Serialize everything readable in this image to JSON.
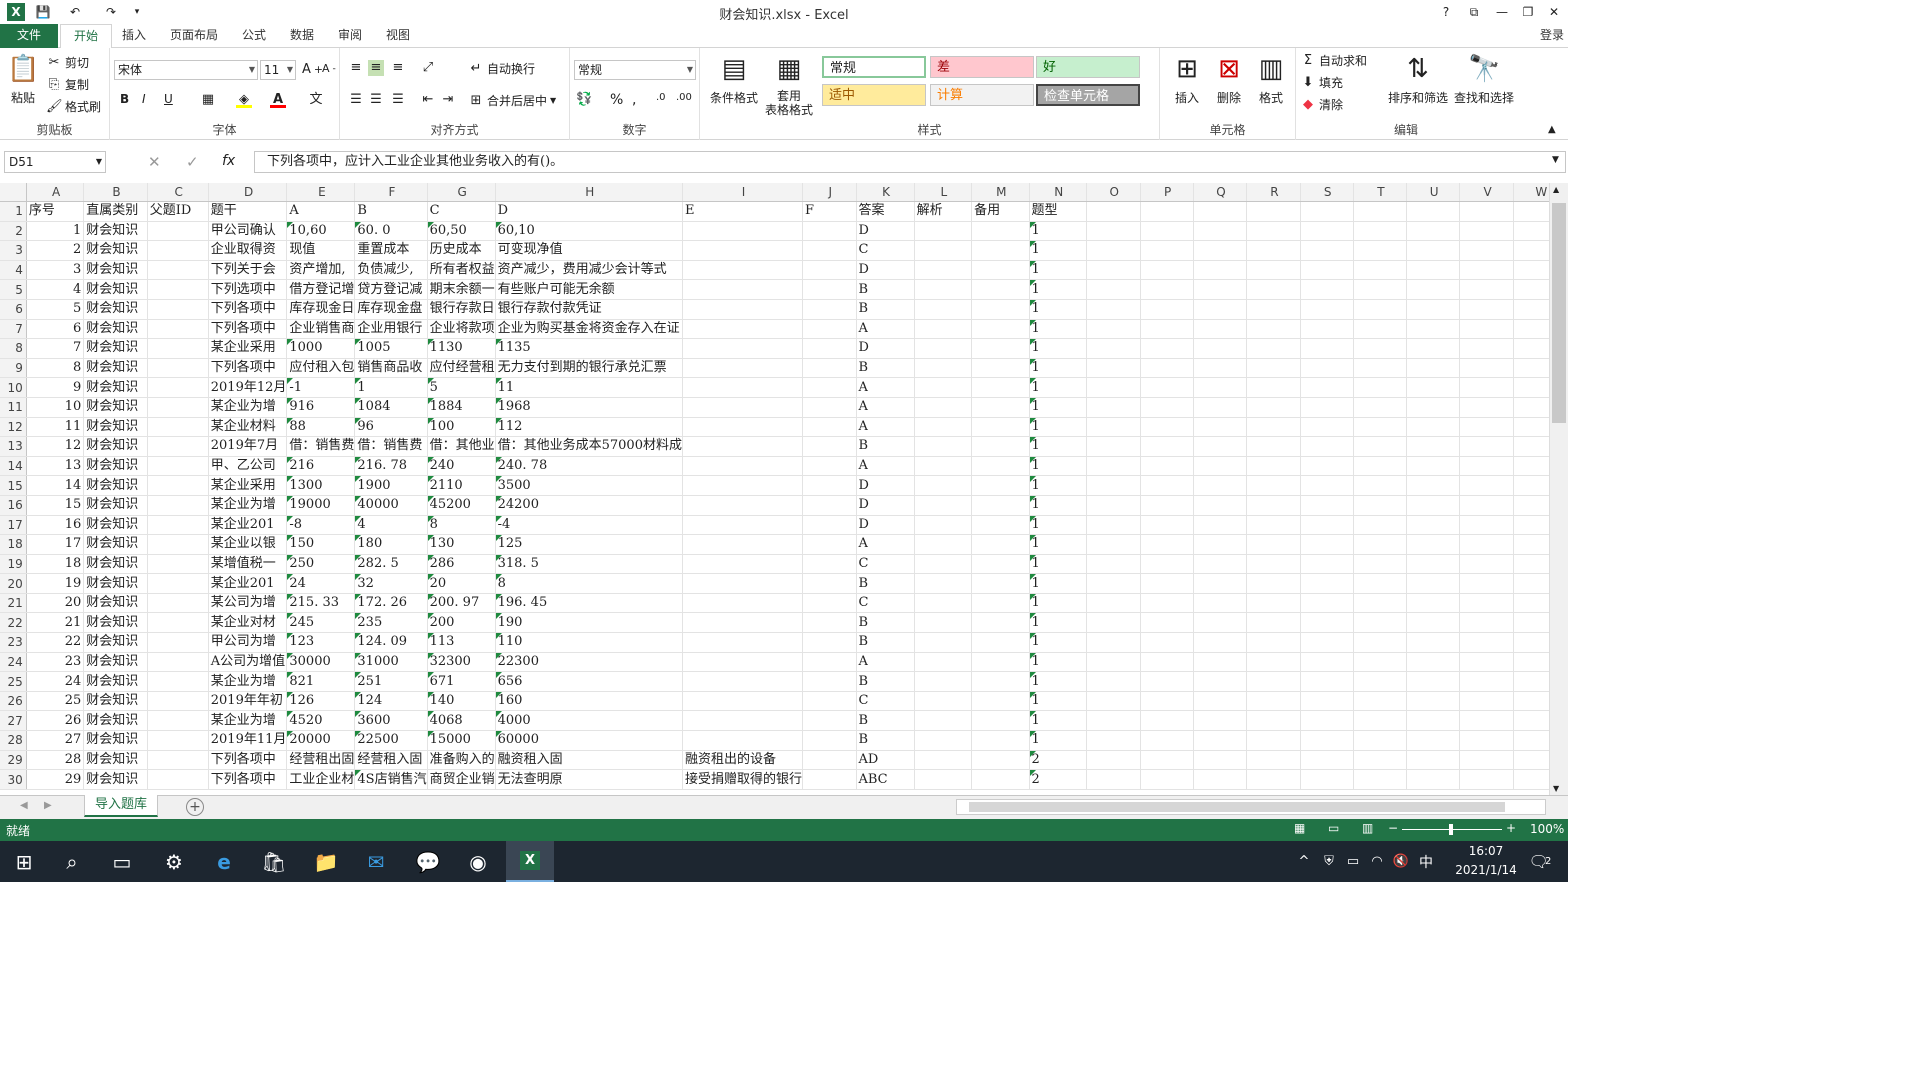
{
  "title_bar": {
    "doc_title": "财会知识.xlsx - Excel",
    "help": "?",
    "restore": "⧉",
    "minimize": "—",
    "maximize": "❐",
    "close": "✕"
  },
  "ribbon_tabs": [
    "文件",
    "开始",
    "插入",
    "页面布局",
    "公式",
    "数据",
    "审阅",
    "视图"
  ],
  "login": "登录",
  "clipboard": {
    "paste": "粘贴",
    "cut": "剪切",
    "copy": "复制",
    "format_painter": "格式刷",
    "label": "剪贴板"
  },
  "font": {
    "name": "宋体",
    "size": "11",
    "label": "字体",
    "bold": "B",
    "italic": "I",
    "underline": "U"
  },
  "alignment": {
    "wrap": "自动换行",
    "merge": "合并后居中",
    "label": "对齐方式"
  },
  "number": {
    "format": "常规",
    "percent": "%",
    "comma": ",",
    "label": "数字"
  },
  "styles": {
    "conditional": "条件格式",
    "table_format": "套用\n表格格式",
    "label": "样式",
    "cells": [
      {
        "text": "常规",
        "bg": "#ffffff",
        "fg": "#222222"
      },
      {
        "text": "差",
        "bg": "#ffc7ce",
        "fg": "#9c0006"
      },
      {
        "text": "好",
        "bg": "#c6efce",
        "fg": "#006100"
      },
      {
        "text": "适中",
        "bg": "#ffeb9c",
        "fg": "#9c5700"
      },
      {
        "text": "计算",
        "bg": "#f2f2f2",
        "fg": "#fa7d00"
      },
      {
        "text": "检查单元格",
        "bg": "#a5a5a5",
        "fg": "#ffffff"
      }
    ]
  },
  "cells_group": {
    "insert": "插入",
    "delete": "删除",
    "format": "格式",
    "label": "单元格"
  },
  "editing": {
    "autosum": "自动求和",
    "fill": "填充",
    "clear": "清除",
    "sort": "排序和筛选",
    "find": "查找和选择",
    "label": "编辑"
  },
  "formula_bar": {
    "name_box": "D51",
    "content": "下列各项中，应计入工业企业其他业务收入的有()。"
  },
  "columns": [
    "A",
    "B",
    "C",
    "D",
    "E",
    "F",
    "G",
    "H",
    "I",
    "J",
    "K",
    "L",
    "M",
    "N",
    "O",
    "P",
    "Q",
    "R",
    "S",
    "T",
    "U",
    "V",
    "W"
  ],
  "header_row": [
    "序号",
    "直属类别",
    "父题ID",
    "题干",
    "A",
    "B",
    "C",
    "D",
    "E",
    "F",
    "答案",
    "解析",
    "备用",
    "题型"
  ],
  "rows": [
    [
      "1",
      "财会知识",
      "",
      "甲公司确认",
      "10,60",
      "60. 0",
      "60,50",
      "60,10",
      "",
      "",
      "D",
      "",
      "",
      "1"
    ],
    [
      "2",
      "财会知识",
      "",
      "企业取得资",
      "现值",
      "重置成本",
      "历史成本",
      "可变现净值",
      "",
      "",
      "C",
      "",
      "",
      "1"
    ],
    [
      "3",
      "财会知识",
      "",
      "下列关于会",
      "资产增加,",
      "负债减少,",
      "所有者权益",
      "资产减少，费用减少会计等式",
      "",
      "",
      "D",
      "",
      "",
      "1"
    ],
    [
      "4",
      "财会知识",
      "",
      "下列选项中",
      "借方登记增",
      "贷方登记减",
      "期末余额一",
      "有些账户可能无余额",
      "",
      "",
      "B",
      "",
      "",
      "1"
    ],
    [
      "5",
      "财会知识",
      "",
      "下列各项中",
      "库存现金日",
      "库存现金盘",
      "银行存款日",
      "银行存款付款凭证",
      "",
      "",
      "B",
      "",
      "",
      "1"
    ],
    [
      "6",
      "财会知识",
      "",
      "下列各项中",
      "企业销售商",
      "企业用银行",
      "企业将款项",
      "企业为购买基金将资金存入在证",
      "",
      "",
      "A",
      "",
      "",
      "1"
    ],
    [
      "7",
      "财会知识",
      "",
      "某企业采用",
      "1000",
      "1005",
      "1130",
      "1135",
      "",
      "",
      "D",
      "",
      "",
      "1"
    ],
    [
      "8",
      "财会知识",
      "",
      "下列各项中",
      "应付租入包",
      "销售商品收",
      "应付经营租",
      "无力支付到期的银行承兑汇票",
      "",
      "",
      "B",
      "",
      "",
      "1"
    ],
    [
      "9",
      "财会知识",
      "",
      "2019年12月",
      "-1",
      "1",
      "5",
      "11",
      "",
      "",
      "A",
      "",
      "",
      "1"
    ],
    [
      "10",
      "财会知识",
      "",
      "某企业为增",
      "916",
      "1084",
      "1884",
      "1968",
      "",
      "",
      "A",
      "",
      "",
      "1"
    ],
    [
      "11",
      "财会知识",
      "",
      "某企业材料",
      "88",
      "96",
      "100",
      "112",
      "",
      "",
      "A",
      "",
      "",
      "1"
    ],
    [
      "12",
      "财会知识",
      "",
      "2019年7月",
      "借：销售费",
      "借：销售费",
      "借：其他业",
      "借：其他业务成本57000材料成",
      "",
      "",
      "B",
      "",
      "",
      "1"
    ],
    [
      "13",
      "财会知识",
      "",
      "甲、乙公司",
      "216",
      "216. 78",
      "240",
      "240. 78",
      "",
      "",
      "A",
      "",
      "",
      "1"
    ],
    [
      "14",
      "财会知识",
      "",
      "某企业采用",
      "1300",
      "1900",
      "2110",
      "3500",
      "",
      "",
      "D",
      "",
      "",
      "1"
    ],
    [
      "15",
      "财会知识",
      "",
      "某企业为增",
      "19000",
      "40000",
      "45200",
      "24200",
      "",
      "",
      "D",
      "",
      "",
      "1"
    ],
    [
      "16",
      "财会知识",
      "",
      "某企业201",
      "-8",
      "4",
      "8",
      "-4",
      "",
      "",
      "D",
      "",
      "",
      "1"
    ],
    [
      "17",
      "财会知识",
      "",
      "某企业以银",
      "150",
      "180",
      "130",
      "125",
      "",
      "",
      "A",
      "",
      "",
      "1"
    ],
    [
      "18",
      "财会知识",
      "",
      "某增值税一",
      "250",
      "282. 5",
      "286",
      "318. 5",
      "",
      "",
      "C",
      "",
      "",
      "1"
    ],
    [
      "19",
      "财会知识",
      "",
      "某企业201",
      "24",
      "32",
      "20",
      "8",
      "",
      "",
      "B",
      "",
      "",
      "1"
    ],
    [
      "20",
      "财会知识",
      "",
      "某公司为增",
      "215. 33",
      "172. 26",
      "200. 97",
      "196. 45",
      "",
      "",
      "C",
      "",
      "",
      "1"
    ],
    [
      "21",
      "财会知识",
      "",
      "某企业对材",
      "245",
      "235",
      "200",
      "190",
      "",
      "",
      "B",
      "",
      "",
      "1"
    ],
    [
      "22",
      "财会知识",
      "",
      "甲公司为增",
      "123",
      "124. 09",
      "113",
      "110",
      "",
      "",
      "B",
      "",
      "",
      "1"
    ],
    [
      "23",
      "财会知识",
      "",
      "A公司为增值",
      "30000",
      "31000",
      "32300",
      "22300",
      "",
      "",
      "A",
      "",
      "",
      "1"
    ],
    [
      "24",
      "财会知识",
      "",
      "某企业为增",
      "821",
      "251",
      "671",
      "656",
      "",
      "",
      "B",
      "",
      "",
      "1"
    ],
    [
      "25",
      "财会知识",
      "",
      "2019年年初",
      "126",
      "124",
      "140",
      "160",
      "",
      "",
      "C",
      "",
      "",
      "1"
    ],
    [
      "26",
      "财会知识",
      "",
      "某企业为增",
      "4520",
      "3600",
      "4068",
      "4000",
      "",
      "",
      "B",
      "",
      "",
      "1"
    ],
    [
      "27",
      "财会知识",
      "",
      "2019年11月",
      "20000",
      "22500",
      "15000",
      "60000",
      "",
      "",
      "B",
      "",
      "",
      "1"
    ],
    [
      "28",
      "财会知识",
      "",
      "下列各项中",
      "经营租出固",
      "经营租入固",
      "准备购入的",
      "融资租入固",
      "融资租出的设备",
      "",
      "AD",
      "",
      "",
      "2"
    ],
    [
      "29",
      "财会知识",
      "",
      "下列各项中",
      "工业企业材",
      "4S店销售汽",
      "商贸企业销",
      "无法查明原",
      "接受捐赠取得的银行",
      "",
      "ABC",
      "",
      "",
      "2"
    ]
  ],
  "sheet_tab": "导入题库",
  "status": {
    "ready": "就绪",
    "zoom": "100%"
  },
  "taskbar": {
    "time": "16:07",
    "date": "2021/1/14",
    "ime": "中",
    "notif_count": "2"
  }
}
